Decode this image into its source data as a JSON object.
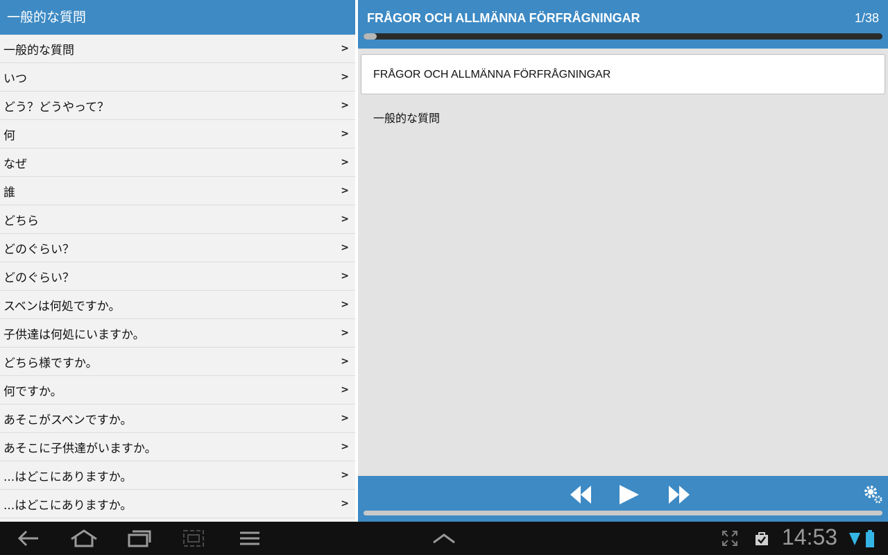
{
  "left": {
    "header": "一般的な質問",
    "items": [
      "一般的な質問",
      "いつ",
      "どう？どうやって？",
      "何",
      "なぜ",
      "誰",
      "どちら",
      "どのぐらい？",
      "どのぐらい？",
      "スベンは何処ですか。",
      "子供達は何処にいますか。",
      "どちら様ですか。",
      "何ですか。",
      "あそこがスベンですか。",
      "あそこに子供達がいますか。",
      "...はどこにありますか。",
      "...はどこにありますか。"
    ],
    "chevron": ">"
  },
  "right": {
    "title": "FRÅGOR OCH ALLMÄNNA FÖRFRÅGNINGAR",
    "counter": "1/38",
    "progress": 0.026,
    "card_text": "FRÅGOR OCH ALLMÄNNA FÖRFRÅGNINGAR",
    "translation": "一般的な質問",
    "player": {
      "icons": [
        "rewind-icon",
        "play-icon",
        "fast-forward-icon",
        "settings-icon"
      ],
      "seek_progress": 0.0
    }
  },
  "statusbar": {
    "time": "14:53",
    "icons": [
      "back-icon",
      "home-icon",
      "recent-apps-icon",
      "screenshot-icon",
      "menu-icon",
      "chevron-up-icon",
      "fullscreen-icon",
      "shopping-bag-icon",
      "wifi-icon",
      "battery-icon"
    ]
  }
}
